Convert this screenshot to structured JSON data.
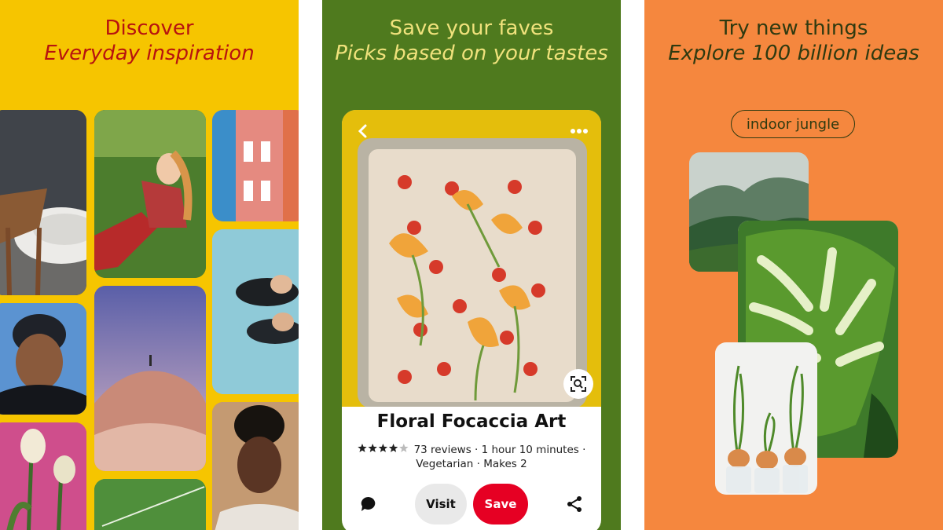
{
  "panels": [
    {
      "headline_line1": "Discover",
      "headline_line2": "Everyday inspiration",
      "background": "#f6c500",
      "text_color": "#b7130f"
    },
    {
      "headline_line1": "Save your faves",
      "headline_line2": "Picks based on your tastes",
      "background": "#4f7a1e",
      "text_color": "#f0e27c",
      "pin": {
        "title": "Floral Focaccia Art",
        "rating": 4,
        "rating_max": 5,
        "meta_line1": "73 reviews · 1 hour 10 minutes ·",
        "meta_line2": "Vegetarian · Makes 2",
        "visit_label": "Visit",
        "save_label": "Save",
        "save_color": "#e60023"
      }
    },
    {
      "headline_line1": "Try new things",
      "headline_line2": "Explore 100 billion ideas",
      "background": "#f5873e",
      "text_color": "#2f3a10",
      "search_term": "indoor jungle"
    }
  ],
  "icons": [
    "chevron-left-icon",
    "more-horizontal-icon",
    "visual-search-icon",
    "comment-icon",
    "share-icon"
  ]
}
